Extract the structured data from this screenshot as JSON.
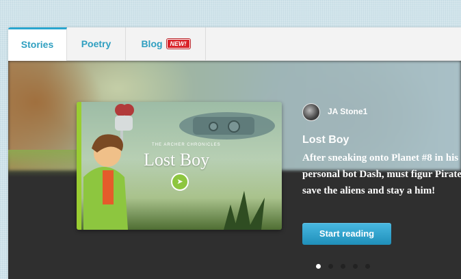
{
  "tabs": [
    {
      "label": "Stories"
    },
    {
      "label": "Poetry"
    },
    {
      "label": "Blog",
      "badge": "NEW!"
    }
  ],
  "featured": {
    "cover": {
      "subtitle": "The Archer Chronicles",
      "title": "Lost Boy"
    },
    "author": {
      "name": "JA Stone1"
    },
    "title": "Lost Boy",
    "description": "After sneaking onto Planet #8 in his personal bot Dash, must figur Pirates, save the aliens and stay a him!",
    "cta": "Start reading"
  },
  "carousel": {
    "total": 5,
    "active": 1
  },
  "colors": {
    "accent": "#2aa6cf",
    "badge": "#d9232a",
    "button": "#2f9fc0"
  },
  "icons": [
    "avatar-image",
    "bird-logo-icon"
  ]
}
